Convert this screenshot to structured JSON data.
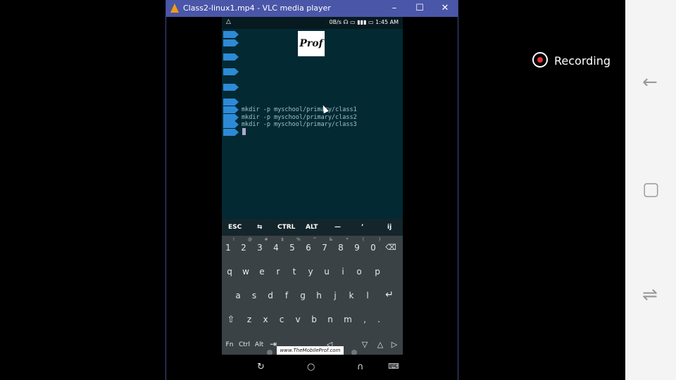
{
  "window": {
    "title": "Class2-linux1.mp4 - VLC media player",
    "minimize": "–",
    "maximize": "☐",
    "close": "✕"
  },
  "status_bar": {
    "left_icon": "warning-icon",
    "right": "0B/s ☊ ▭ ▮▮▮ ▭ 1:45 AM",
    "time": "1:45 AM",
    "speed": "0B/s"
  },
  "logo": {
    "text": "Prof"
  },
  "terminal": {
    "lines": [
      "mkdir -p myschool/primary/class1",
      "mkdir -p myschool/primary/class2",
      "mkdir -p myschool/primary/class3"
    ]
  },
  "extra_keys": [
    "ESC",
    "⇆",
    "CTRL",
    "ALT",
    "—",
    "’",
    "ij"
  ],
  "keyboard": {
    "row_numbers": [
      "1",
      "2",
      "3",
      "4",
      "5",
      "6",
      "7",
      "8",
      "9",
      "0"
    ],
    "row_numbers_sup": [
      "!",
      "@",
      "#",
      "$",
      "%",
      "^",
      "&",
      "*",
      "(",
      ")"
    ],
    "row_q": [
      "q",
      "w",
      "e",
      "r",
      "t",
      "y",
      "u",
      "i",
      "o",
      "p"
    ],
    "row_a": [
      "a",
      "s",
      "d",
      "f",
      "g",
      "h",
      "j",
      "k",
      "l"
    ],
    "row_z": [
      "z",
      "x",
      "c",
      "v",
      "b",
      "n",
      "m",
      ",",
      "."
    ],
    "bottom": [
      "Fn",
      "Ctrl",
      "Alt",
      "⇥",
      "◁",
      "▽",
      "△",
      "▷"
    ]
  },
  "watermark": "www.TheMobileProf.com",
  "recording": {
    "label": "Recording"
  },
  "colors": {
    "vlc_title": "#4a56a8",
    "terminal_bg": "#032933",
    "prompt": "#2d8ad6",
    "record": "#e53030"
  }
}
